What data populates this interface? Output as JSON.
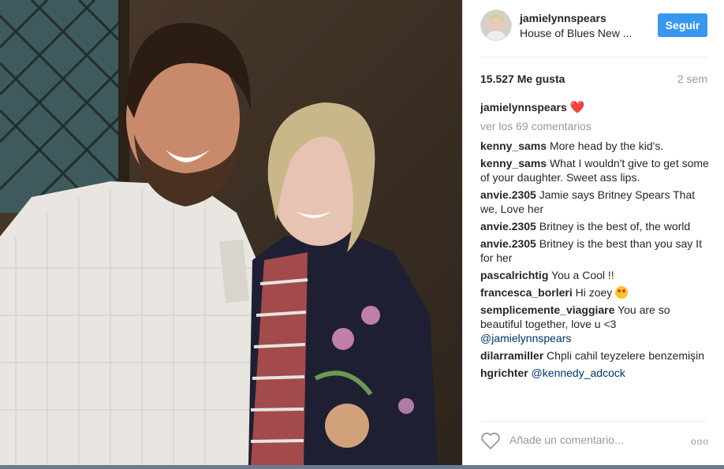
{
  "post": {
    "username": "jamielynnspears",
    "location": "House of Blues New ...",
    "follow_label": "Seguir",
    "likes": "15.527 Me gusta",
    "time_ago": "2 sem",
    "caption_user": "jamielynnspears",
    "caption_emoji": "❤️",
    "view_all": "ver los 69 comentarios"
  },
  "comments": [
    {
      "user": "kenny_sams",
      "text": "More head by the kid's."
    },
    {
      "user": "kenny_sams",
      "text": "What I wouldn't give to get some of your daughter. Sweet ass lips."
    },
    {
      "user": "anvie.2305",
      "text": "Jamie says Britney Spears That we, Love her"
    },
    {
      "user": "anvie.2305",
      "text": "Britney is the best of, the world"
    },
    {
      "user": "anvie.2305",
      "text": "Britney is the best than you say It for her"
    },
    {
      "user": "pascalrichtig",
      "text": "You a Cool !!"
    },
    {
      "user": "francesca_borleri",
      "text": "Hi zoey"
    },
    {
      "user": "semplicemente_viaggiare",
      "text": "You are so beautiful together, love u <3",
      "mention": "@jamielynnspears"
    },
    {
      "user": "dilarramiller",
      "text": "Chpli cahil teyzelere benzemişin"
    },
    {
      "user": "hgrichter",
      "mention": "@kennedy_adcock"
    }
  ],
  "footer": {
    "add_comment_placeholder": "Añade un comentario...",
    "more_label": "ooo"
  },
  "colors": {
    "follow_button": "#3897f0",
    "muted_text": "#999999",
    "mention": "#003569"
  },
  "icons": {
    "like": "heart-outline-icon",
    "more": "more-options-icon"
  }
}
